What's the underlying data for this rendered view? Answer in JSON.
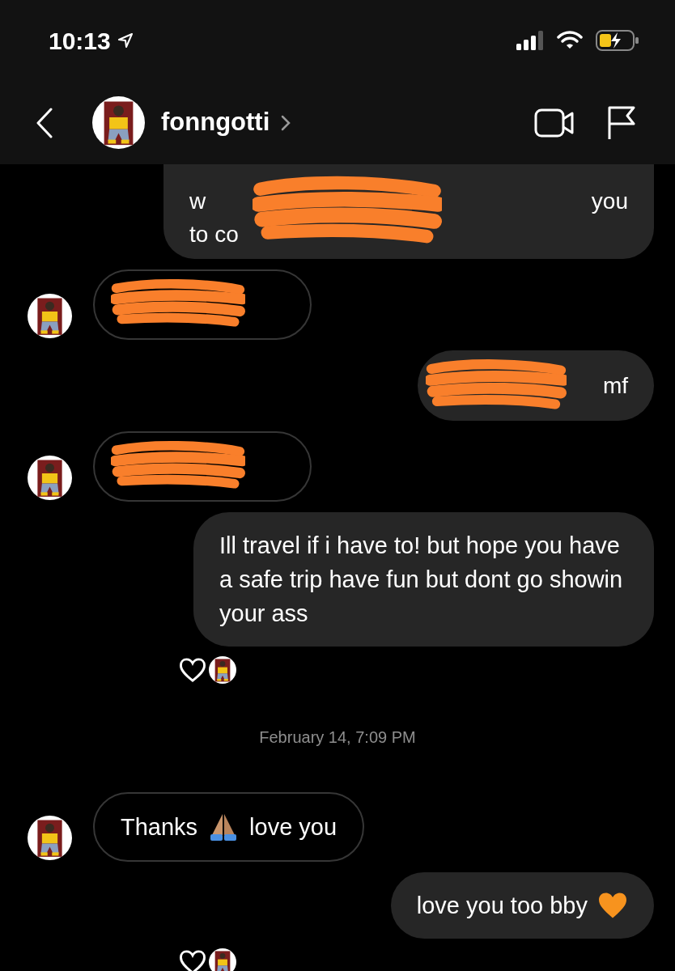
{
  "status_bar": {
    "time": "10:13"
  },
  "header": {
    "name": "fonngotti"
  },
  "messages": [
    {
      "kind": "outgoing",
      "redacted": true,
      "cut_top": true,
      "lines": [
        [
          "w",
          "you"
        ],
        [
          "to co"
        ]
      ],
      "reaction": false
    },
    {
      "kind": "incoming",
      "redacted": true,
      "reaction": false
    },
    {
      "kind": "outgoing",
      "redacted": true,
      "lines": [
        [
          "mf"
        ]
      ],
      "reaction": false
    },
    {
      "kind": "incoming",
      "redacted": true,
      "reaction": false
    },
    {
      "kind": "outgoing",
      "redacted": false,
      "parts": [
        {
          "kind": "text",
          "text": "Ill travel if i have to! but hope you have a safe trip have fun but dont go showin your ass"
        }
      ],
      "reaction": true
    },
    {
      "kind": "date",
      "text": "February 14, 7:09 PM"
    },
    {
      "kind": "incoming",
      "redacted": false,
      "parts": [
        {
          "kind": "text",
          "text": "Thanks"
        },
        {
          "kind": "hands"
        },
        {
          "kind": "text",
          "text": "love you"
        }
      ],
      "reaction": false
    },
    {
      "kind": "outgoing",
      "redacted": false,
      "parts": [
        {
          "kind": "text",
          "text": "love you too bby"
        },
        {
          "kind": "heart"
        }
      ],
      "reaction": true
    }
  ]
}
